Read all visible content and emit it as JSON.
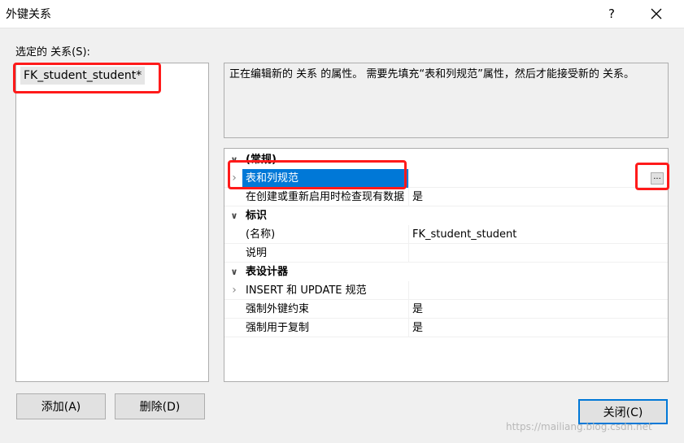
{
  "window": {
    "title": "外键关系",
    "help_glyph": "?",
    "close_glyph": "×"
  },
  "relations": {
    "label": "选定的 关系(S):",
    "items": [
      "FK_student_student*"
    ]
  },
  "description": "正在编辑新的 关系 的属性。 需要先填充“表和列规范”属性，然后才能接受新的 关系。",
  "grid": {
    "categories": [
      {
        "name": "(常规)",
        "properties": [
          {
            "name": "表和列规范",
            "value": ""
          },
          {
            "name": "在创建或重新启用时检查现有数据",
            "value": "是"
          }
        ]
      },
      {
        "name": "标识",
        "properties": [
          {
            "name": "(名称)",
            "value": "FK_student_student"
          },
          {
            "name": "说明",
            "value": ""
          }
        ]
      },
      {
        "name": "表设计器",
        "properties": [
          {
            "name": "INSERT 和 UPDATE 规范",
            "value": ""
          },
          {
            "name": "强制外键约束",
            "value": "是"
          },
          {
            "name": "强制用于复制",
            "value": "是"
          }
        ]
      }
    ],
    "ellipsis_label": "..."
  },
  "buttons": {
    "add": "添加(A)",
    "delete": "删除(D)",
    "close": "关闭(C)"
  },
  "watermark": "https://mailiang.blog.csdn.net",
  "colors": {
    "selection": "#0078d7",
    "highlight_box": "#ff1a1a"
  }
}
